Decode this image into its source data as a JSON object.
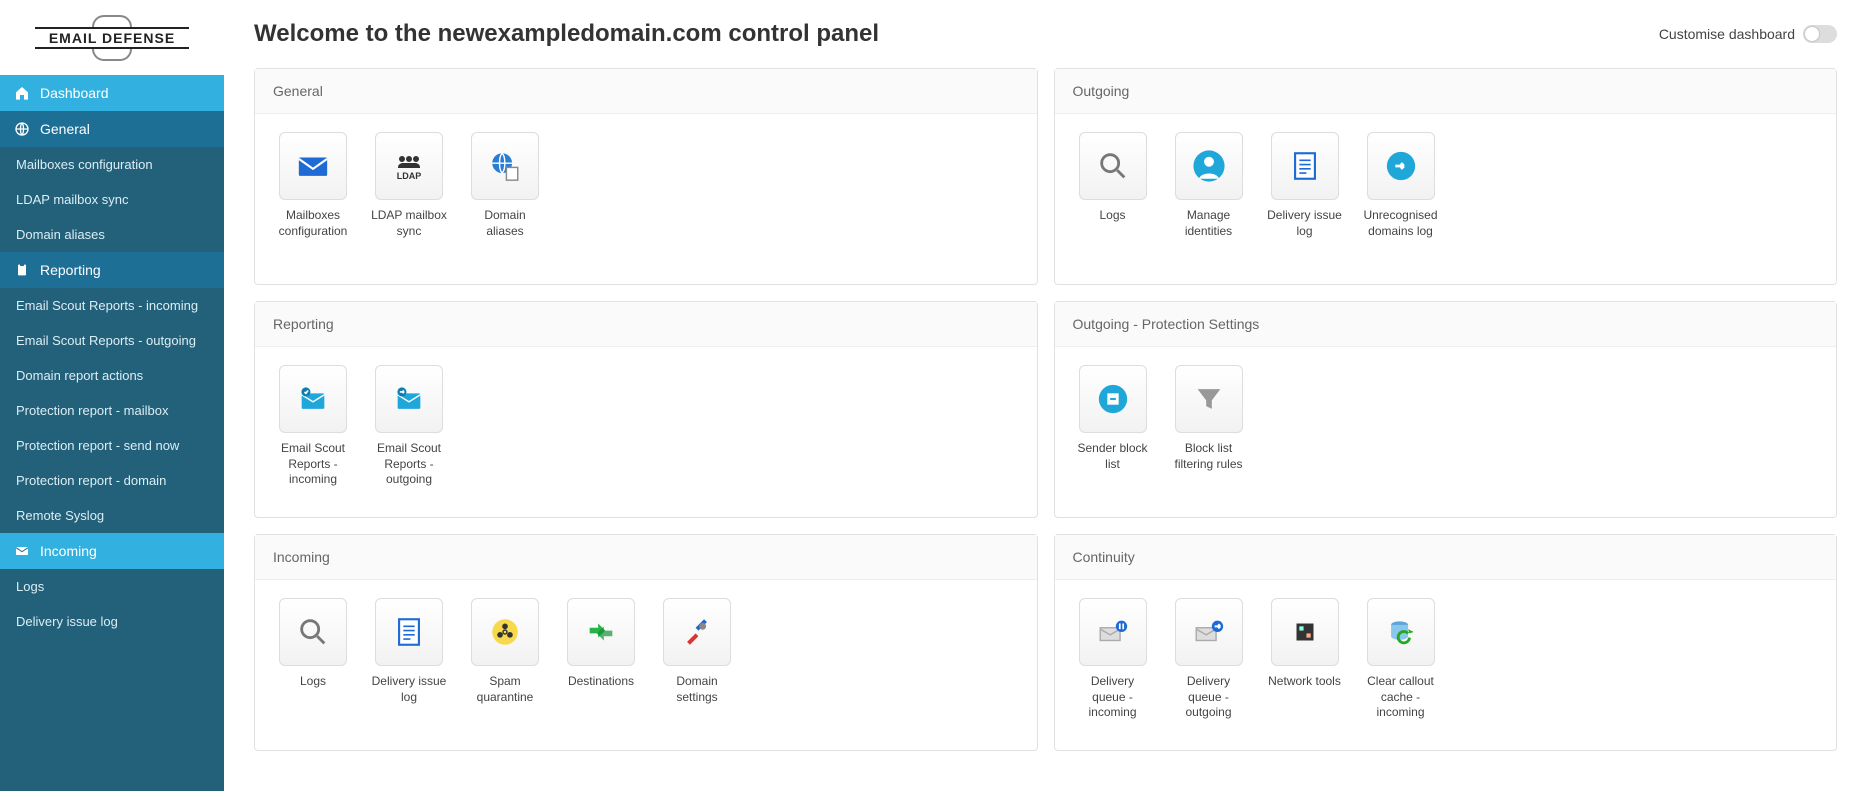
{
  "logo_text": "EMAIL DEFENSE",
  "page_title": "Welcome to the newexampledomain.com control panel",
  "customise_label": "Customise dashboard",
  "sidebar": {
    "sections": [
      {
        "label": "Dashboard",
        "icon": "home",
        "style": "light",
        "items": []
      },
      {
        "label": "General",
        "icon": "globe",
        "style": "dark",
        "items": [
          {
            "label": "Mailboxes configuration"
          },
          {
            "label": "LDAP mailbox sync"
          },
          {
            "label": "Domain aliases"
          }
        ]
      },
      {
        "label": "Reporting",
        "icon": "clipboard",
        "style": "dark",
        "items": [
          {
            "label": "Email Scout Reports - incoming"
          },
          {
            "label": "Email Scout Reports - outgoing"
          },
          {
            "label": "Domain report actions"
          },
          {
            "label": "Protection report - mailbox"
          },
          {
            "label": "Protection report - send now"
          },
          {
            "label": "Protection report - domain"
          },
          {
            "label": "Remote Syslog"
          }
        ]
      },
      {
        "label": "Incoming",
        "icon": "envelope",
        "style": "light",
        "items": [
          {
            "label": "Logs"
          },
          {
            "label": "Delivery issue log"
          }
        ]
      }
    ]
  },
  "panels": [
    {
      "title": "General",
      "col": 0,
      "tiles": [
        {
          "label": "Mailboxes configuration",
          "icon": "envelope"
        },
        {
          "label": "LDAP mailbox sync",
          "icon": "ldap"
        },
        {
          "label": "Domain aliases",
          "icon": "globe-doc"
        }
      ]
    },
    {
      "title": "Outgoing",
      "col": 1,
      "tiles": [
        {
          "label": "Logs",
          "icon": "magnifier"
        },
        {
          "label": "Manage identities",
          "icon": "person"
        },
        {
          "label": "Delivery issue log",
          "icon": "doc-lines"
        },
        {
          "label": "Unrecognised domains log",
          "icon": "arrow-circle"
        }
      ]
    },
    {
      "title": "Reporting",
      "col": 0,
      "tiles": [
        {
          "label": "Email Scout Reports - incoming",
          "icon": "mail-in"
        },
        {
          "label": "Email Scout Reports - outgoing",
          "icon": "mail-out"
        }
      ]
    },
    {
      "title": "Outgoing - Protection Settings",
      "col": 1,
      "tiles": [
        {
          "label": "Sender block list",
          "icon": "blocklist"
        },
        {
          "label": "Block list filtering rules",
          "icon": "funnel"
        }
      ]
    },
    {
      "title": "Incoming",
      "col": 0,
      "tiles": [
        {
          "label": "Logs",
          "icon": "magnifier"
        },
        {
          "label": "Delivery issue log",
          "icon": "doc-lines"
        },
        {
          "label": "Spam quarantine",
          "icon": "biohazard"
        },
        {
          "label": "Destinations",
          "icon": "arrows"
        },
        {
          "label": "Domain settings",
          "icon": "tools"
        }
      ]
    },
    {
      "title": "Continuity",
      "col": 1,
      "tiles": [
        {
          "label": "Delivery queue - incoming",
          "icon": "queue-in"
        },
        {
          "label": "Delivery queue - outgoing",
          "icon": "queue-out"
        },
        {
          "label": "Network tools",
          "icon": "network"
        },
        {
          "label": "Clear callout cache - incoming",
          "icon": "db-refresh"
        }
      ]
    }
  ]
}
